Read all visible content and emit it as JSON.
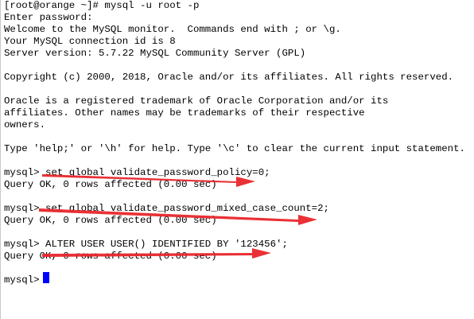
{
  "terminal": {
    "lines": [
      "[root@orange ~]# mysql -u root -p",
      "Enter password:",
      "Welcome to the MySQL monitor.  Commands end with ; or \\g.",
      "Your MySQL connection id is 8",
      "Server version: 5.7.22 MySQL Community Server (GPL)",
      "Copyright (c) 2000, 2018, Oracle and/or its affiliates. All rights reserved.",
      "Oracle is a registered trademark of Oracle Corporation and/or its",
      "affiliates. Other names may be trademarks of their respective",
      "owners.",
      "Type 'help;' or '\\h' for help. Type '\\c' to clear the current input statement.",
      "mysql> set global validate_password_policy=0;",
      "Query OK, 0 rows affected (0.00 sec)",
      "mysql> set global validate_password_mixed_case_count=2;",
      "Query OK, 0 rows affected (0.00 sec)",
      "mysql> ALTER USER USER() IDENTIFIED BY '123456';",
      "Query OK, 0 rows affected (0.00 sec)",
      "mysql> "
    ]
  },
  "colors": {
    "text": "#000000",
    "cursor": "#0000ff",
    "annotation_arrow": "#e8262b"
  }
}
